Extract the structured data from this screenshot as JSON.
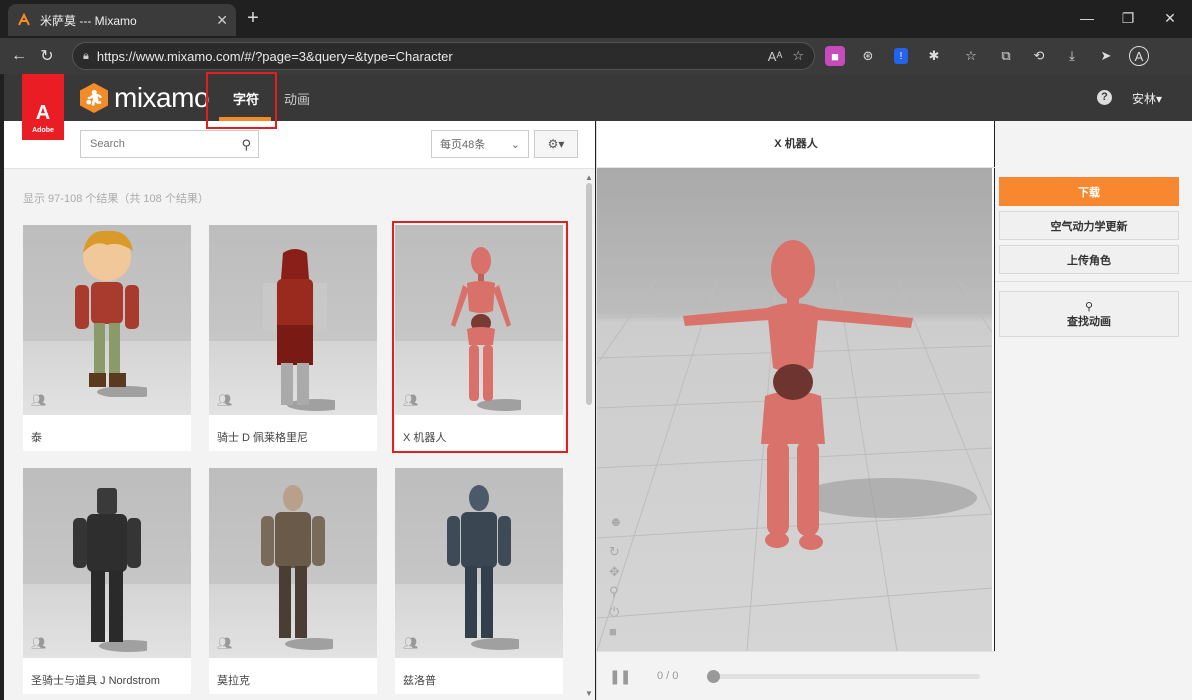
{
  "browser": {
    "tab_title": "米萨莫 --- Mixamo",
    "url": "https://www.mixamo.com/#/?page=3&query=&type=Character"
  },
  "header": {
    "brand_adobe": "Adobe",
    "brand": "mixamo",
    "nav": [
      "字符",
      "动画"
    ],
    "user": "安林▾"
  },
  "toolbar": {
    "search_placeholder": "Search",
    "per_page": "每页48条"
  },
  "results_text": "显示 97-108 个结果（共 108 个结果）",
  "characters": [
    {
      "name": "泰"
    },
    {
      "name": "骑士 D 佩莱格里尼"
    },
    {
      "name": "X 机器人"
    },
    {
      "name": "圣骑士与道具 J Nordstrom"
    },
    {
      "name": "莫拉克"
    },
    {
      "name": "兹洛普"
    }
  ],
  "viewer": {
    "title": "X 机器人",
    "progress": "0 / 0"
  },
  "actions": {
    "download": "下载",
    "aero": "空气动力学更新",
    "upload": "上传角色",
    "find": "查找动画"
  }
}
